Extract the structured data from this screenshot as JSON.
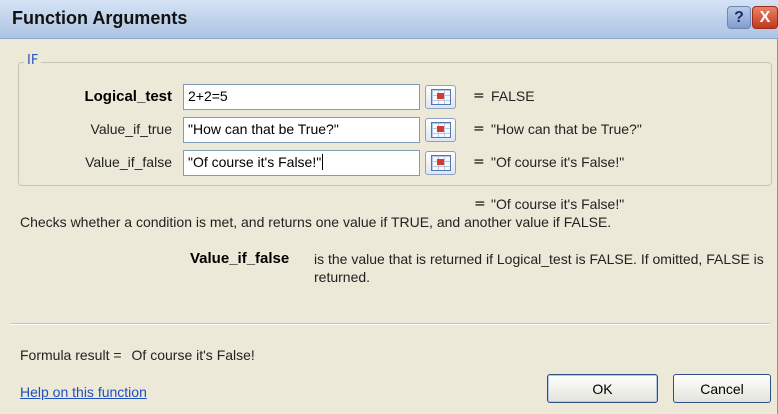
{
  "window": {
    "title": "Function Arguments",
    "help_glyph": "?",
    "close_glyph": "X"
  },
  "function": {
    "name": "IF",
    "arguments": [
      {
        "label": "Logical_test",
        "input": "2+2=5",
        "equals": "=",
        "evaluated": "FALSE",
        "active": false
      },
      {
        "label": "Value_if_true",
        "input": "\"How can that be True?\"",
        "equals": "=",
        "evaluated": "\"How can that be True?\"",
        "active": false
      },
      {
        "label": "Value_if_false",
        "input": "\"Of course it's False!\"",
        "equals": "=",
        "evaluated": "\"Of course it's False!\"",
        "active": true
      }
    ],
    "result_equals": "=",
    "result_value": "\"Of course it's False!\"",
    "description": "Checks whether a condition is met, and returns one value if TRUE, and another value if FALSE."
  },
  "argument_help": {
    "name": "Value_if_false",
    "text": "is the value that is returned if Logical_test is FALSE. If omitted, FALSE is returned."
  },
  "footer": {
    "formula_result_label": "Formula result =",
    "formula_result_value": "Of course it's False!",
    "help_link": "Help on this function",
    "ok_label": "OK",
    "cancel_label": "Cancel"
  },
  "icons": {
    "ref_button": "collapse-dialog-icon"
  }
}
